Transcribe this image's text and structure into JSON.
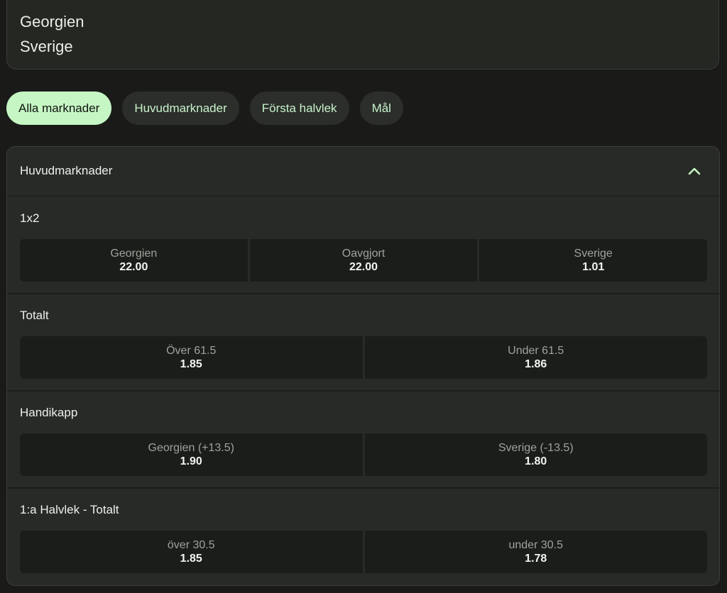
{
  "teams": {
    "home": "Georgien",
    "away": "Sverige"
  },
  "filters": [
    {
      "label": "Alla marknader",
      "active": true
    },
    {
      "label": "Huvudmarknader",
      "active": false
    },
    {
      "label": "Första halvlek",
      "active": false
    },
    {
      "label": "Mål",
      "active": false
    }
  ],
  "panel": {
    "title": "Huvudmarknader",
    "icon": "chevron-up-icon",
    "accent": "#c6f6c4"
  },
  "markets": [
    {
      "title": "1x2",
      "outcomes": [
        {
          "label": "Georgien",
          "odds": "22.00"
        },
        {
          "label": "Oavgjort",
          "odds": "22.00"
        },
        {
          "label": "Sverige",
          "odds": "1.01"
        }
      ]
    },
    {
      "title": "Totalt",
      "outcomes": [
        {
          "label": "Över 61.5",
          "odds": "1.85"
        },
        {
          "label": "Under 61.5",
          "odds": "1.86"
        }
      ]
    },
    {
      "title": "Handikapp",
      "outcomes": [
        {
          "label": "Georgien (+13.5)",
          "odds": "1.90"
        },
        {
          "label": "Sverige (-13.5)",
          "odds": "1.80"
        }
      ]
    },
    {
      "title": "1:a Halvlek - Totalt",
      "outcomes": [
        {
          "label": "över 30.5",
          "odds": "1.85"
        },
        {
          "label": "under 30.5",
          "odds": "1.78"
        }
      ]
    }
  ]
}
